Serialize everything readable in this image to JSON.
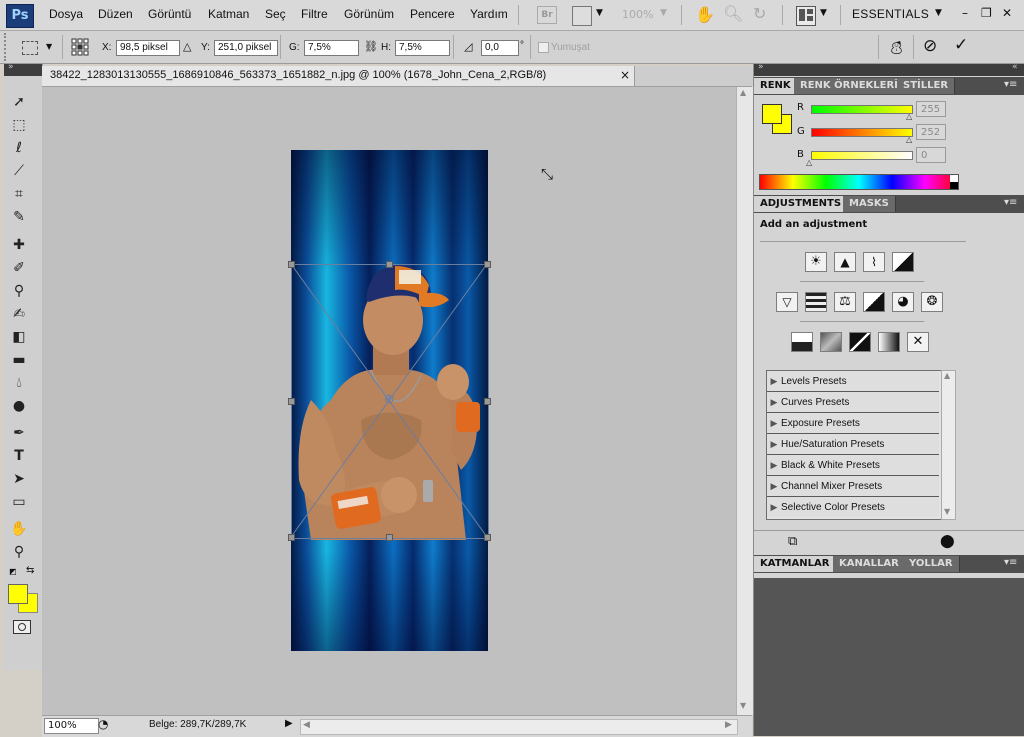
{
  "app": {
    "logo": "Ps",
    "menus": [
      "Dosya",
      "Düzen",
      "Görüntü",
      "Katman",
      "Seç",
      "Filtre",
      "Görünüm",
      "Pencere",
      "Yardım"
    ],
    "bridge_label": "Br",
    "zoom_menu": "100%",
    "workspace": "ESSENTIALS"
  },
  "options": {
    "x_label": "X:",
    "x_value": "98,5 piksel",
    "y_label": "Y:",
    "y_value": "251,0 piksel",
    "w_label": "G:",
    "w_value": "7,5%",
    "h_label": "H:",
    "h_value": "7,5%",
    "angle_value": "0,0",
    "angle_unit": "°",
    "smooth_label": "Yumuşat"
  },
  "document": {
    "tab_title": "38422_1283013130555_1686910846_563373_1651882_n.jpg @ 100% (1678_John_Cena_2,RGB/8)",
    "close": "×",
    "zoom": "100%",
    "info": "Belge: 289,7K/289,7K"
  },
  "color_panel": {
    "tabs": [
      "RENK",
      "RENK ÖRNEKLERİ",
      "STİLLER"
    ],
    "r_label": "R",
    "r_value": "255",
    "g_label": "G",
    "g_value": "252",
    "b_label": "B",
    "b_value": "0",
    "foreground": "#ffff00",
    "background": "#ffff00"
  },
  "adjustments_panel": {
    "tabs": [
      "ADJUSTMENTS",
      "MASKS"
    ],
    "heading": "Add an adjustment",
    "presets": [
      "Levels Presets",
      "Curves Presets",
      "Exposure Presets",
      "Hue/Saturation Presets",
      "Black & White Presets",
      "Channel Mixer Presets",
      "Selective Color Presets"
    ]
  },
  "layers_panel": {
    "tabs": [
      "KATMANLAR",
      "KANALLAR",
      "YOLLAR"
    ]
  },
  "tools": [
    "move-icon",
    "marquee-icon",
    "lasso-icon",
    "quick-select-icon",
    "crop-icon",
    "eyedropper-icon",
    "healing-brush-icon",
    "brush-icon",
    "clone-stamp-icon",
    "history-brush-icon",
    "eraser-icon",
    "gradient-icon",
    "blur-icon",
    "dodge-icon",
    "pen-icon",
    "type-icon",
    "path-select-icon",
    "shape-icon",
    "hand-icon",
    "zoom-icon"
  ]
}
